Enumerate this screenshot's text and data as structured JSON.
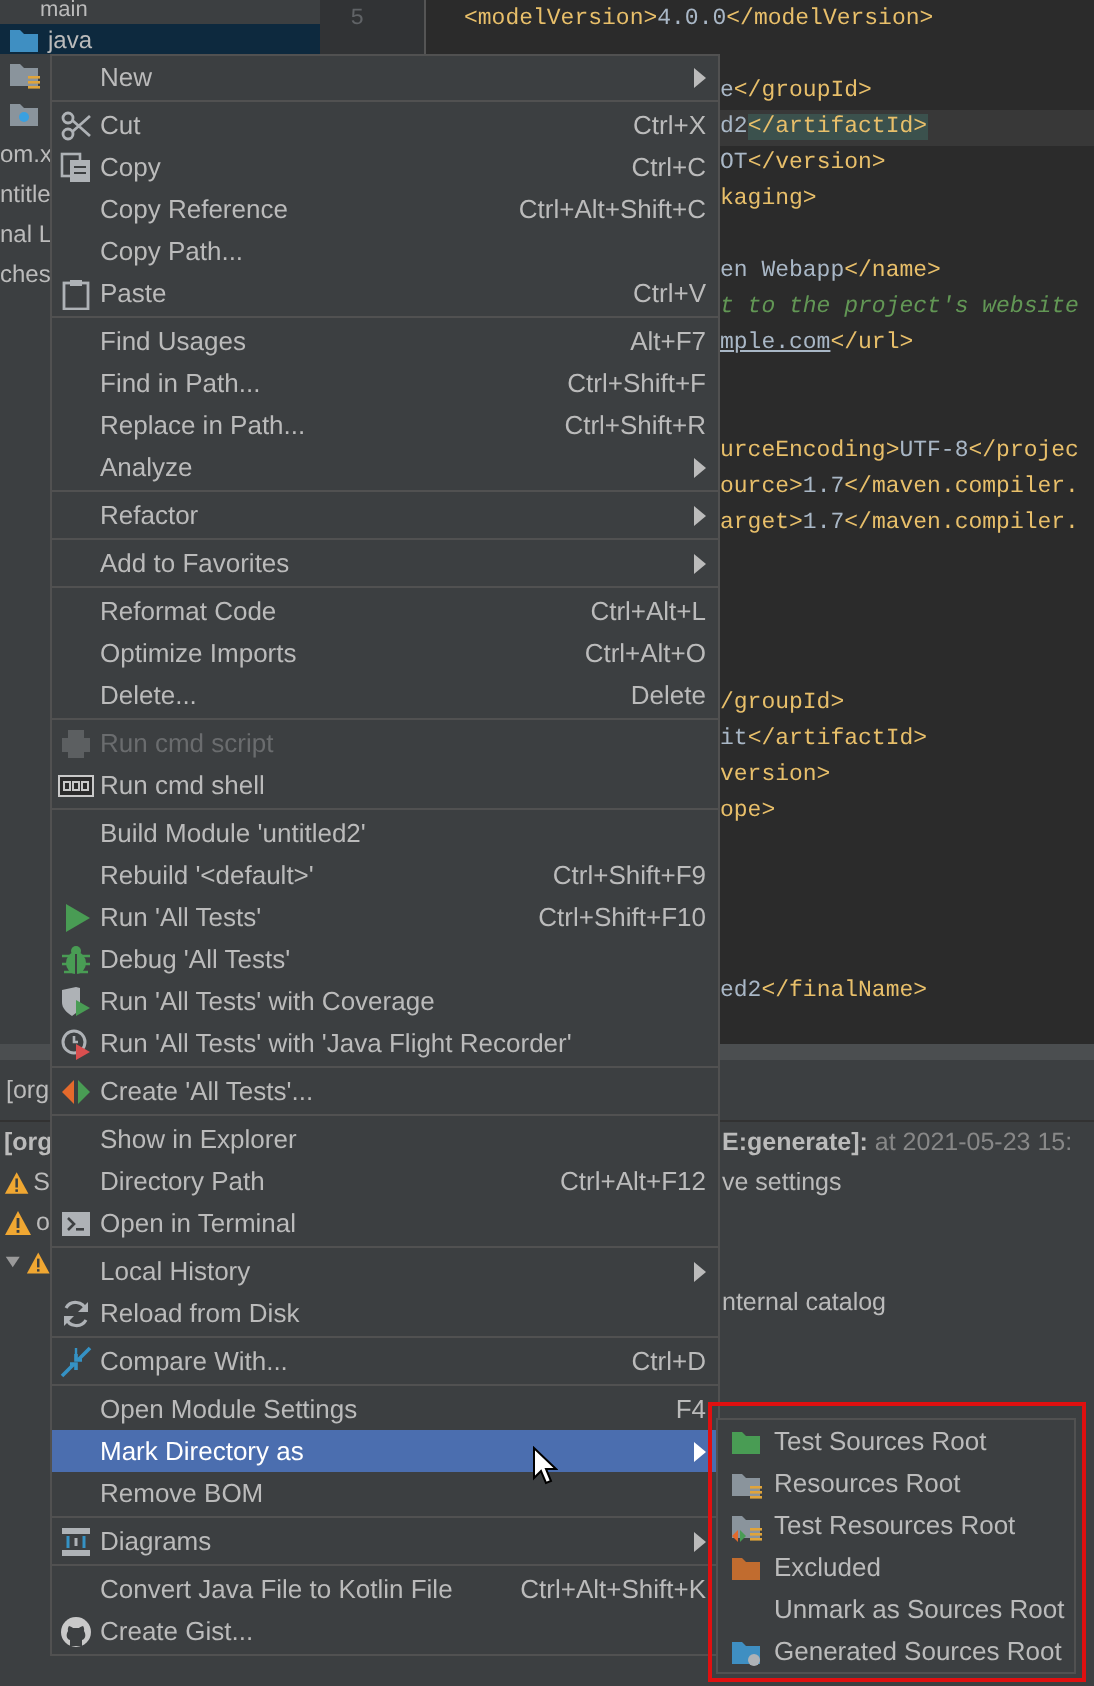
{
  "project_tree": [
    {
      "label": "main",
      "selected": false
    },
    {
      "label": "java",
      "selected": true
    },
    {
      "selected": false
    },
    {
      "selected": false
    },
    {
      "label": "om.x",
      "selected": false
    },
    {
      "label": "ntitle",
      "selected": false
    },
    {
      "label": "nal L",
      "selected": false
    },
    {
      "label": "ches",
      "selected": false
    }
  ],
  "gutter": {
    "line_number": "5"
  },
  "editor": {
    "lines": [
      {
        "kind": "full",
        "segments": [
          {
            "kind": "tag",
            "text": "<modelVersion>"
          },
          {
            "kind": "text",
            "text": "4.0.0"
          },
          {
            "kind": "tag",
            "text": "</modelVersion>"
          }
        ]
      },
      {
        "kind": "blank"
      },
      {
        "kind": "partial",
        "segments": [
          {
            "kind": "text",
            "text": "e"
          },
          {
            "kind": "tag",
            "text": "</groupId>"
          }
        ]
      },
      {
        "kind": "partial",
        "highlighted": true,
        "segments": [
          {
            "kind": "text",
            "text": "d2"
          },
          {
            "kind": "match",
            "text": "</artifactId>"
          }
        ]
      },
      {
        "kind": "partial",
        "segments": [
          {
            "kind": "text",
            "text": "OT"
          },
          {
            "kind": "tag",
            "text": "</version>"
          }
        ]
      },
      {
        "kind": "partial",
        "segments": [
          {
            "kind": "tag",
            "text": "kaging>"
          }
        ]
      },
      {
        "kind": "blank"
      },
      {
        "kind": "partial",
        "segments": [
          {
            "kind": "text",
            "text": "en Webapp"
          },
          {
            "kind": "tag",
            "text": "</name>"
          }
        ]
      },
      {
        "kind": "partial",
        "segments": [
          {
            "kind": "comment",
            "text": "t to the project's website"
          }
        ]
      },
      {
        "kind": "partial",
        "segments": [
          {
            "kind": "link",
            "text": "mple.com"
          },
          {
            "kind": "tag",
            "text": "</url>"
          }
        ]
      },
      {
        "kind": "blank"
      },
      {
        "kind": "blank"
      },
      {
        "kind": "partial",
        "segments": [
          {
            "kind": "tag",
            "text": "urceEncoding>"
          },
          {
            "kind": "text",
            "text": "UTF-8"
          },
          {
            "kind": "tag",
            "text": "</projec"
          }
        ]
      },
      {
        "kind": "partial",
        "segments": [
          {
            "kind": "tag",
            "text": "ource>"
          },
          {
            "kind": "text",
            "text": "1.7"
          },
          {
            "kind": "tag",
            "text": "</maven.compiler."
          }
        ]
      },
      {
        "kind": "partial",
        "segments": [
          {
            "kind": "tag",
            "text": "arget>"
          },
          {
            "kind": "text",
            "text": "1.7"
          },
          {
            "kind": "tag",
            "text": "</maven.compiler."
          }
        ]
      },
      {
        "kind": "blank"
      },
      {
        "kind": "blank"
      },
      {
        "kind": "blank"
      },
      {
        "kind": "blank"
      },
      {
        "kind": "partial",
        "segments": [
          {
            "kind": "tag",
            "text": "/groupId>"
          }
        ]
      },
      {
        "kind": "partial",
        "segments": [
          {
            "kind": "text",
            "text": "it"
          },
          {
            "kind": "tag",
            "text": "</artifactId>"
          }
        ]
      },
      {
        "kind": "partial",
        "segments": [
          {
            "kind": "tag",
            "text": "version>"
          }
        ]
      },
      {
        "kind": "partial",
        "segments": [
          {
            "kind": "tag",
            "text": "ope>"
          }
        ]
      },
      {
        "kind": "blank"
      },
      {
        "kind": "blank"
      },
      {
        "kind": "blank"
      },
      {
        "kind": "blank"
      },
      {
        "kind": "partial",
        "segments": [
          {
            "kind": "text",
            "text": "ed2"
          },
          {
            "kind": "tag",
            "text": "</finalName>"
          }
        ]
      }
    ]
  },
  "run_panel": {
    "tab": "[org",
    "rows": [
      {
        "left": {
          "text": "[org",
          "bold": true
        },
        "right": [
          {
            "kind": "bold",
            "text": "E:generate]:"
          },
          {
            "kind": "muted",
            "text": " at 2021-05-23 15:"
          }
        ]
      },
      {
        "left": {
          "text": "S",
          "kind": "warning"
        },
        "right": [
          {
            "kind": "plain",
            "text": "ve settings"
          }
        ]
      },
      {
        "left": {
          "text": "o",
          "kind": "warning"
        }
      },
      {
        "left": {
          "kind": "warning",
          "expanded": true
        }
      },
      {
        "right": [
          {
            "kind": "plain",
            "text": "nternal catalog"
          }
        ]
      }
    ]
  },
  "context_menu": {
    "groups": [
      [
        {
          "label": "New",
          "has_submenu": true,
          "disabled": false,
          "selected": false
        }
      ],
      [
        {
          "label": "Cut",
          "shortcut": "Ctrl+X",
          "has_submenu": false,
          "disabled": false,
          "selected": false
        },
        {
          "label": "Copy",
          "shortcut": "Ctrl+C",
          "has_submenu": false,
          "disabled": false,
          "selected": false
        },
        {
          "label": "Copy Reference",
          "shortcut": "Ctrl+Alt+Shift+C",
          "has_submenu": false,
          "disabled": false,
          "selected": false
        },
        {
          "label": "Copy Path...",
          "has_submenu": false,
          "disabled": false,
          "selected": false
        },
        {
          "label": "Paste",
          "shortcut": "Ctrl+V",
          "has_submenu": false,
          "disabled": false,
          "selected": false
        }
      ],
      [
        {
          "label": "Find Usages",
          "shortcut": "Alt+F7",
          "has_submenu": false,
          "disabled": false,
          "selected": false
        },
        {
          "label": "Find in Path...",
          "shortcut": "Ctrl+Shift+F",
          "has_submenu": false,
          "disabled": false,
          "selected": false
        },
        {
          "label": "Replace in Path...",
          "shortcut": "Ctrl+Shift+R",
          "has_submenu": false,
          "disabled": false,
          "selected": false
        },
        {
          "label": "Analyze",
          "has_submenu": true,
          "disabled": false,
          "selected": false
        }
      ],
      [
        {
          "label": "Refactor",
          "has_submenu": true,
          "disabled": false,
          "selected": false
        }
      ],
      [
        {
          "label": "Add to Favorites",
          "has_submenu": true,
          "disabled": false,
          "selected": false
        }
      ],
      [
        {
          "label": "Reformat Code",
          "shortcut": "Ctrl+Alt+L",
          "has_submenu": false,
          "disabled": false,
          "selected": false
        },
        {
          "label": "Optimize Imports",
          "shortcut": "Ctrl+Alt+O",
          "has_submenu": false,
          "disabled": false,
          "selected": false
        },
        {
          "label": "Delete...",
          "shortcut": "Delete",
          "has_submenu": false,
          "disabled": false,
          "selected": false
        }
      ],
      [
        {
          "label": "Run cmd script",
          "has_submenu": false,
          "disabled": true,
          "selected": false
        },
        {
          "label": "Run cmd shell",
          "has_submenu": false,
          "disabled": false,
          "selected": false
        }
      ],
      [
        {
          "label": "Build Module 'untitled2'",
          "has_submenu": false,
          "disabled": false,
          "selected": false
        },
        {
          "label": "Rebuild '<default>'",
          "shortcut": "Ctrl+Shift+F9",
          "has_submenu": false,
          "disabled": false,
          "selected": false
        },
        {
          "label": "Run 'All Tests'",
          "shortcut": "Ctrl+Shift+F10",
          "has_submenu": false,
          "disabled": false,
          "selected": false
        },
        {
          "label": "Debug 'All Tests'",
          "has_submenu": false,
          "disabled": false,
          "selected": false
        },
        {
          "label": "Run 'All Tests' with Coverage",
          "has_submenu": false,
          "disabled": false,
          "selected": false
        },
        {
          "label": "Run 'All Tests' with 'Java Flight Recorder'",
          "has_submenu": false,
          "disabled": false,
          "selected": false
        }
      ],
      [
        {
          "label": "Create 'All Tests'...",
          "has_submenu": false,
          "disabled": false,
          "selected": false
        }
      ],
      [
        {
          "label": "Show in Explorer",
          "has_submenu": false,
          "disabled": false,
          "selected": false
        },
        {
          "label": "Directory Path",
          "shortcut": "Ctrl+Alt+F12",
          "has_submenu": false,
          "disabled": false,
          "selected": false
        },
        {
          "label": "Open in Terminal",
          "has_submenu": false,
          "disabled": false,
          "selected": false
        }
      ],
      [
        {
          "label": "Local History",
          "has_submenu": true,
          "disabled": false,
          "selected": false
        },
        {
          "label": "Reload from Disk",
          "has_submenu": false,
          "disabled": false,
          "selected": false
        }
      ],
      [
        {
          "label": "Compare With...",
          "shortcut": "Ctrl+D",
          "has_submenu": false,
          "disabled": false,
          "selected": false
        }
      ],
      [
        {
          "label": "Open Module Settings",
          "shortcut": "F4",
          "has_submenu": false,
          "disabled": false,
          "selected": false
        },
        {
          "label": "Mark Directory as",
          "has_submenu": true,
          "disabled": false,
          "selected": true
        },
        {
          "label": "Remove BOM",
          "has_submenu": false,
          "disabled": false,
          "selected": false
        }
      ],
      [
        {
          "label": "Diagrams",
          "has_submenu": true,
          "disabled": false,
          "selected": false
        }
      ],
      [
        {
          "label": "Convert Java File to Kotlin File",
          "shortcut": "Ctrl+Alt+Shift+K",
          "has_submenu": false,
          "disabled": false,
          "selected": false
        },
        {
          "label": "Create Gist...",
          "has_submenu": false,
          "disabled": false,
          "selected": false
        }
      ]
    ]
  },
  "submenu": {
    "items": [
      {
        "label": "Test Sources Root"
      },
      {
        "label": "Resources Root"
      },
      {
        "label": "Test Resources Root"
      },
      {
        "label": "Excluded"
      },
      {
        "label": "Unmark as Sources Root"
      },
      {
        "label": "Generated Sources Root"
      }
    ]
  }
}
